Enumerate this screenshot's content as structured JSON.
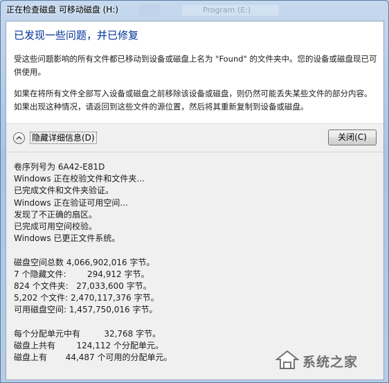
{
  "window": {
    "title": "正在检查磁盘 可移动磁盘 (H:)",
    "background_hint": "Program (E:)"
  },
  "summary": {
    "heading": "已发现一些问题，并已修复",
    "paragraph1": "受这些问题影响的所有文件都已移动到设备或磁盘上名为 \"Found\" 的文件夹中。您的设备或磁盘现已可供使用。",
    "paragraph2": "如果在将所有文件全部写入设备或磁盘之前移除该设备或磁盘，则仍然可能丢失某些文件的部分内容。如果出现这种情况，请返回到这些文件的源位置，然后将其重新复制到设备或磁盘。"
  },
  "controls": {
    "toggle_details_label": "隐藏详细信息(D)",
    "close_label": "关闭(C)"
  },
  "details": {
    "log": [
      "卷序列号为 6A42-E81D",
      "Windows 正在校验文件和文件夹...",
      "已完成文件和文件夹验证。",
      "Windows 正在验证可用空间...",
      "发现了不正确的扇区。",
      "已完成可用空间校验。",
      "Windows 已更正文件系统。"
    ],
    "stats": [
      "磁盘空间总数 4,066,902,016 字节。",
      "7 个隐藏文件:        294,912 字节。",
      "824 个文件夹:   27,033,600 字节。",
      "5,202 个文件: 2,470,117,376 字节。",
      "可用磁盘空间: 1,457,750,016 字节。"
    ],
    "alloc": [
      "每个分配单元中有         32,768 字节。",
      "磁盘上共有        124,112 个分配单元。",
      "磁盘上有       44,487 个可用的分配单元。"
    ]
  },
  "watermark": {
    "text": "系统之家",
    "icon": "house-logo-icon"
  }
}
